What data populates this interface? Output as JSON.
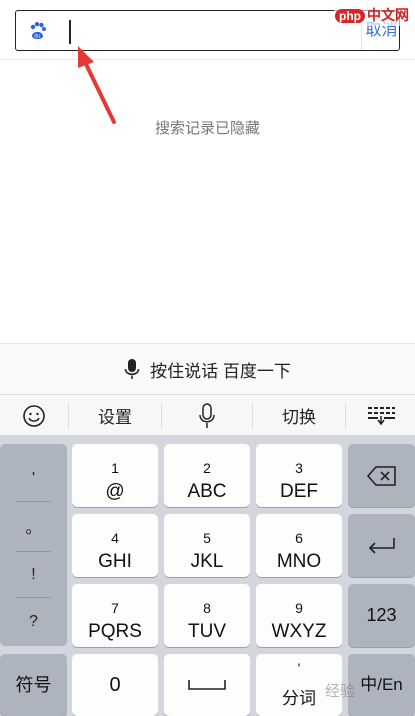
{
  "search": {
    "value": "",
    "cancel_label": "取消",
    "logo_icon": "baidu-paw-icon"
  },
  "watermark_top": {
    "badge": "php",
    "text": "中文网"
  },
  "history": {
    "hidden_text": "搜索记录已隐藏"
  },
  "voice": {
    "label": "按住说话 百度一下",
    "icon": "microphone-icon"
  },
  "toolbar": {
    "emoji_icon": "emoji-icon",
    "settings_label": "设置",
    "mic_icon": "microphone-icon",
    "switch_label": "切换",
    "hide_keyboard_icon": "keyboard-hide-icon"
  },
  "keyboard": {
    "punctuation": [
      "'",
      "。",
      "!",
      "?"
    ],
    "keys": [
      {
        "num": "1",
        "letters": "@"
      },
      {
        "num": "2",
        "letters": "ABC"
      },
      {
        "num": "3",
        "letters": "DEF"
      },
      {
        "num": "4",
        "letters": "GHI"
      },
      {
        "num": "5",
        "letters": "JKL"
      },
      {
        "num": "6",
        "letters": "MNO"
      },
      {
        "num": "7",
        "letters": "PQRS"
      },
      {
        "num": "8",
        "letters": "TUV"
      },
      {
        "num": "9",
        "letters": "WXYZ"
      }
    ],
    "backspace_icon": "backspace-icon",
    "enter_icon": "return-icon",
    "num_label": "123",
    "symbols_label": "符号",
    "zero_label": "0",
    "space_icon": "space-icon",
    "segment_label": "分词",
    "lang_label": "中/En"
  },
  "watermark_bottom": {
    "text": "经验"
  },
  "colors": {
    "accent": "#3a6fd8",
    "arrow": "#e53935",
    "key_dark": "#aeb4bd",
    "keyboard_bg": "#d3d7dd"
  }
}
